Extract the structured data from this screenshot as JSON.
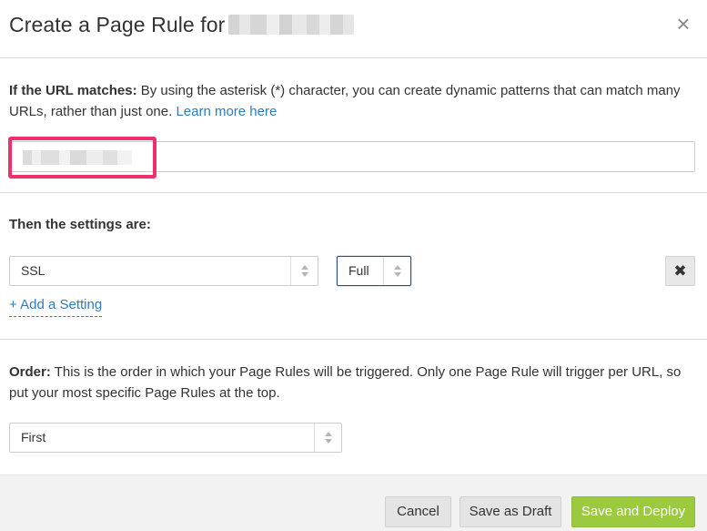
{
  "modal": {
    "title": "Create a Page Rule for",
    "close_label": "×"
  },
  "url_section": {
    "label": "If the URL matches:",
    "description": " By using the asterisk (*) character, you can create dynamic patterns that can match many URLs, rather than just one. ",
    "learn_more": "Learn more here",
    "input_value": ""
  },
  "settings_section": {
    "heading": "Then the settings are:",
    "setting_select": "SSL",
    "value_select": "Full",
    "remove_label": "✖",
    "add_setting": "+ Add a Setting"
  },
  "order_section": {
    "label": "Order:",
    "description": " This is the order in which your Page Rules will be triggered. Only one Page Rule will trigger per URL, so put your most specific Page Rules at the top.",
    "order_select": "First"
  },
  "footer": {
    "cancel": "Cancel",
    "save_draft": "Save as Draft",
    "save_deploy": "Save and Deploy"
  },
  "colors": {
    "primary": "#9bca3e",
    "link": "#2f7bbf",
    "highlight": "#f0306b"
  }
}
